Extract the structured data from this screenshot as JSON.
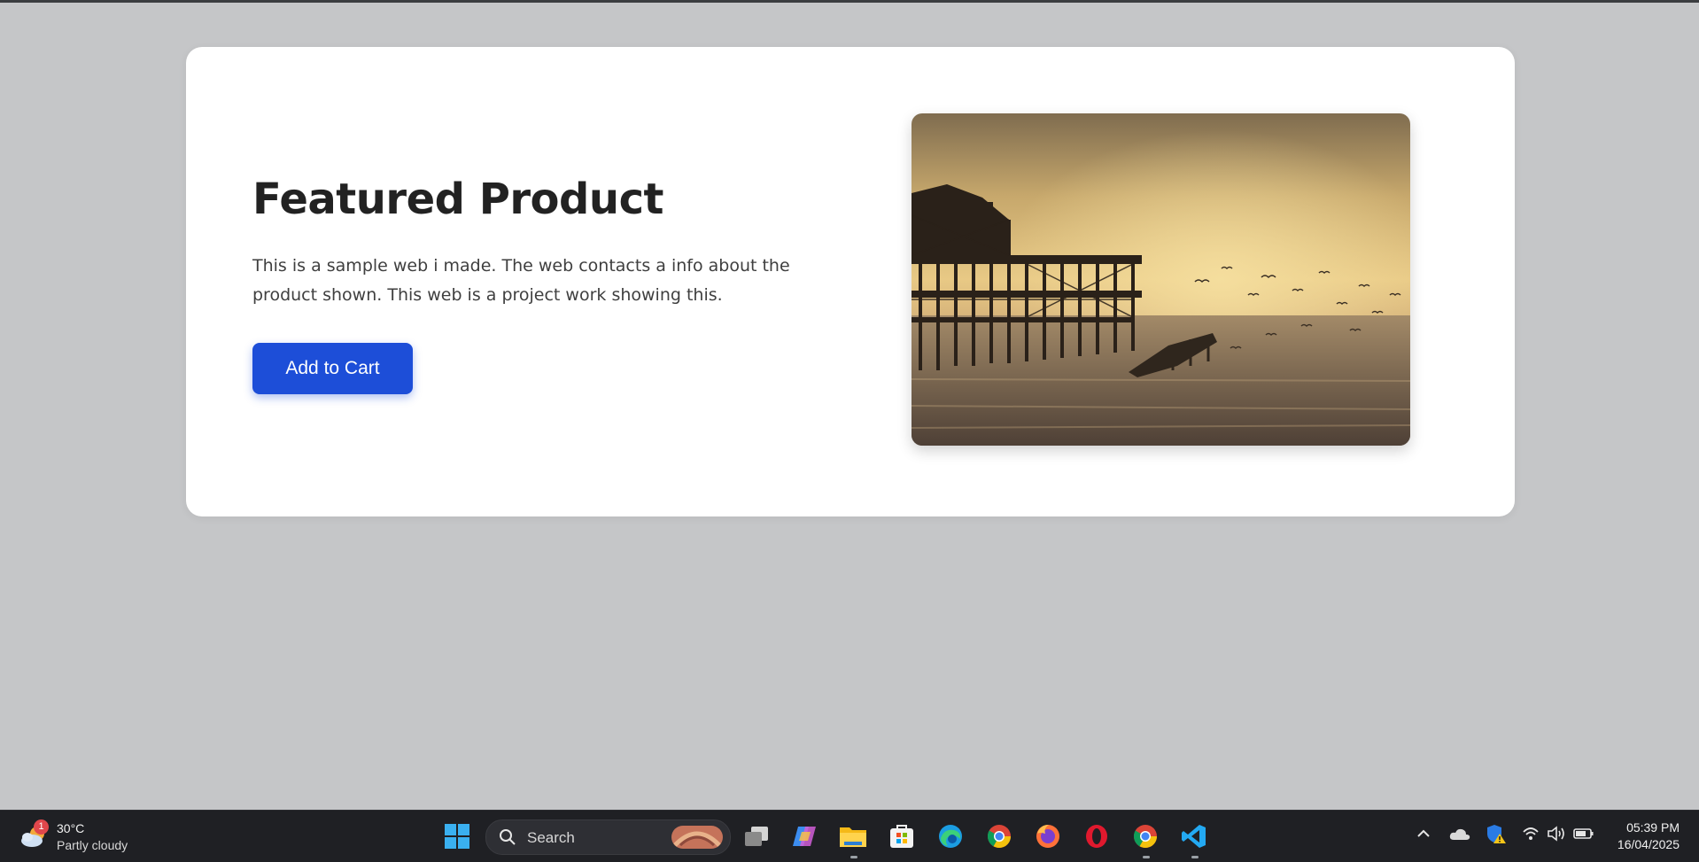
{
  "card": {
    "title": "Featured Product",
    "description": "This is a sample web i made. The web contacts a info about the product shown. This web is a project work showing this.",
    "button_label": "Add to Cart"
  },
  "taskbar": {
    "weather": {
      "temp": "30°C",
      "condition": "Partly cloudy",
      "badge": "1"
    },
    "search_label": "Search",
    "apps": [
      "windows-start",
      "task-view",
      "copilot",
      "file-explorer",
      "microsoft-store",
      "edge",
      "chrome",
      "firefox",
      "opera",
      "chrome",
      "vscode"
    ],
    "clock": {
      "time": "05:39 PM",
      "date": "16/04/2025"
    }
  },
  "colors": {
    "accent": "#1d4ed8",
    "background": "#c5c6c8",
    "taskbar": "#1f2024"
  }
}
